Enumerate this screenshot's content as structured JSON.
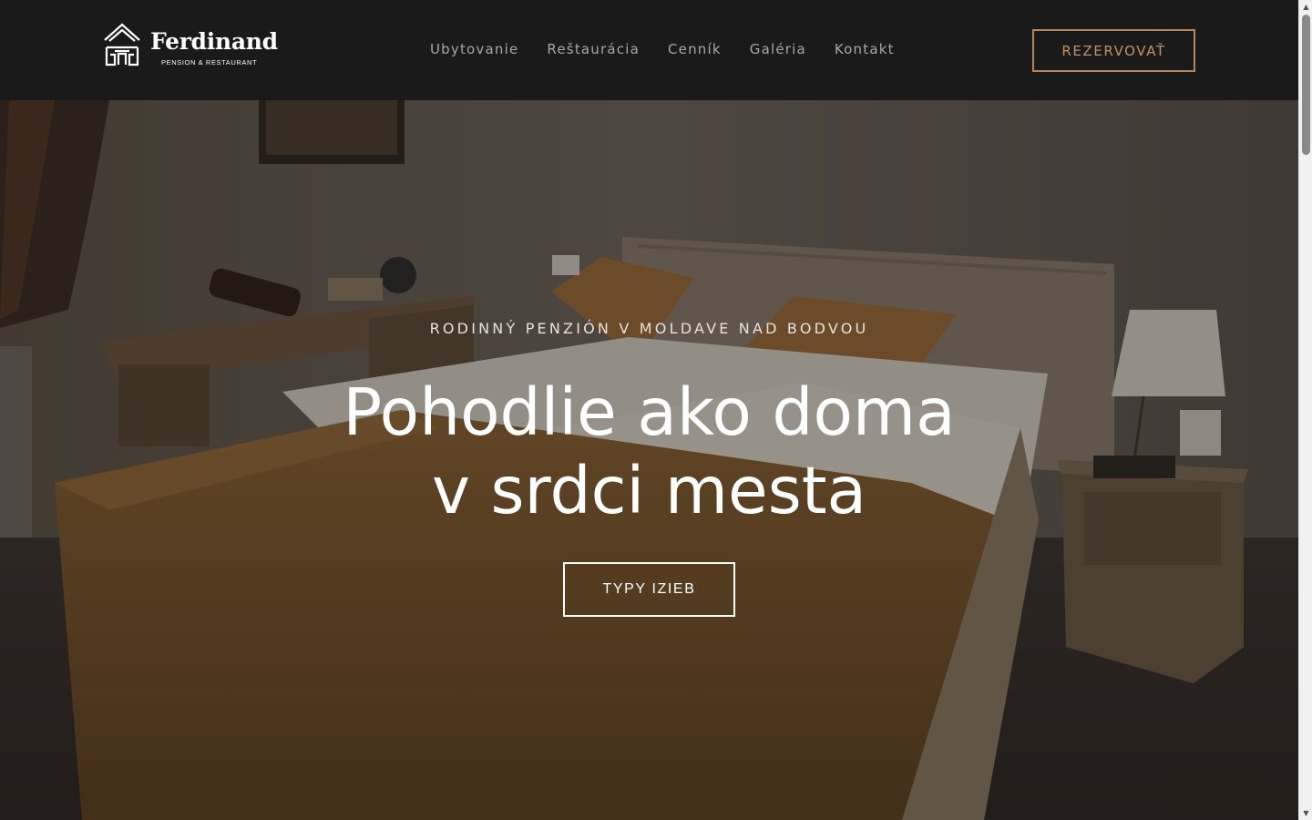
{
  "header": {
    "logo_name": "Ferdinand",
    "logo_sub": "PENSION & RESTAURANT",
    "nav": [
      {
        "label": "Ubytovanie"
      },
      {
        "label": "Reštaurácia"
      },
      {
        "label": "Cenník"
      },
      {
        "label": "Galéria"
      },
      {
        "label": "Kontakt"
      }
    ],
    "cta_label": "REZERVOVAŤ"
  },
  "hero": {
    "subtitle": "RODINNÝ PENZIÓN V MOLDAVE NAD BODVOU",
    "title_line1": "Pohodlie ako doma",
    "title_line2": "v srdci mesta",
    "button_label": "TYPY IZIEB"
  },
  "colors": {
    "header_bg": "#1a1a1a",
    "accent": "#c49064",
    "nav_text": "#a7a7a7"
  },
  "icons": {
    "logo": "house-logo-icon",
    "scroll_up": "chevron-up-icon",
    "scroll_down": "chevron-down-icon"
  }
}
